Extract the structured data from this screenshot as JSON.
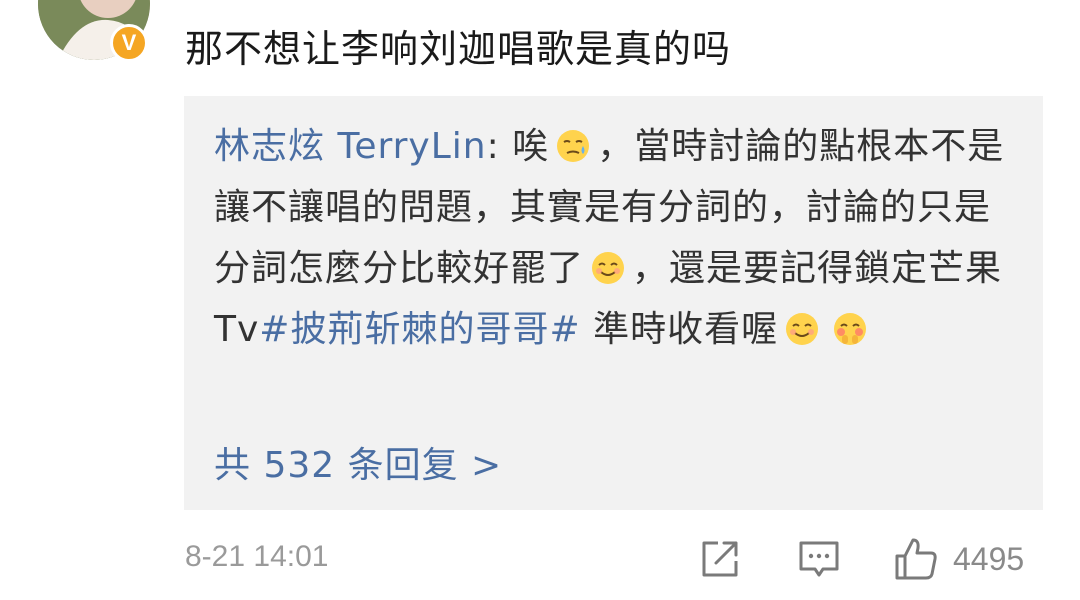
{
  "comment": {
    "text": "那不想让李响刘迦唱歌是真的吗",
    "time": "8-21 14:01",
    "likes": "4495"
  },
  "user": {
    "verified_mark": "V"
  },
  "reply": {
    "author": "林志炫 TerryLin",
    "sep": ": ",
    "text_1": "唉",
    "text_2": "，當時討論的點根本不是讓不讓唱的問題，其實是有分詞的，討論的只是分詞怎麼分比較好罷了",
    "text_3": "，還是要記得鎖定芒果 Tv",
    "hashtag": "#披荊斩棘的哥哥#",
    "text_4": " 準時收看喔",
    "more_replies": "共 532 条回复 >"
  },
  "icons": {
    "share": "share-icon",
    "reply": "comment-icon",
    "like": "thumbs-up-icon"
  },
  "colors": {
    "link": "#4a6ea3",
    "badge": "#f5a623",
    "reply_bg": "#f2f2f2"
  }
}
